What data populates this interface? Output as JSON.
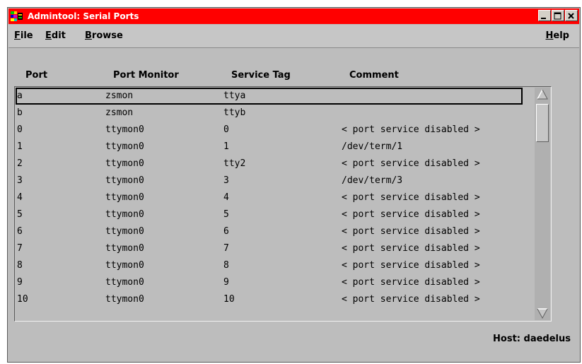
{
  "window": {
    "title": "Admintool: Serial Ports"
  },
  "menu": {
    "file": "File",
    "edit": "Edit",
    "browse": "Browse",
    "help": "Help"
  },
  "columns": {
    "port": "Port",
    "monitor": "Port Monitor",
    "tag": "Service Tag",
    "comment": "Comment"
  },
  "rows": [
    {
      "port": "a",
      "monitor": "zsmon",
      "tag": "ttya",
      "comment": "",
      "selected": true
    },
    {
      "port": "b",
      "monitor": "zsmon",
      "tag": "ttyb",
      "comment": ""
    },
    {
      "port": "0",
      "monitor": "ttymon0",
      "tag": "0",
      "comment": "< port service disabled >"
    },
    {
      "port": "1",
      "monitor": "ttymon0",
      "tag": "1",
      "comment": "/dev/term/1"
    },
    {
      "port": "2",
      "monitor": "ttymon0",
      "tag": "tty2",
      "comment": "< port service disabled >"
    },
    {
      "port": "3",
      "monitor": "ttymon0",
      "tag": "3",
      "comment": "/dev/term/3"
    },
    {
      "port": "4",
      "monitor": "ttymon0",
      "tag": "4",
      "comment": "< port service disabled >"
    },
    {
      "port": "5",
      "monitor": "ttymon0",
      "tag": "5",
      "comment": "< port service disabled >"
    },
    {
      "port": "6",
      "monitor": "ttymon0",
      "tag": "6",
      "comment": "< port service disabled >"
    },
    {
      "port": "7",
      "monitor": "ttymon0",
      "tag": "7",
      "comment": "< port service disabled >"
    },
    {
      "port": "8",
      "monitor": "ttymon0",
      "tag": "8",
      "comment": "< port service disabled >"
    },
    {
      "port": "9",
      "monitor": "ttymon0",
      "tag": "9",
      "comment": "< port service disabled >"
    },
    {
      "port": "10",
      "monitor": "ttymon0",
      "tag": "10",
      "comment": "< port service disabled >"
    }
  ],
  "status": {
    "host": "Host: daedelus"
  },
  "colors": {
    "titlebar": "#ff0000",
    "window_bg": "#bdbdbd",
    "selection_border": "#000000"
  },
  "icons": {
    "app": "admintool-icon",
    "minimize": "minimize-icon",
    "maximize": "maximize-icon",
    "close": "close-icon"
  }
}
